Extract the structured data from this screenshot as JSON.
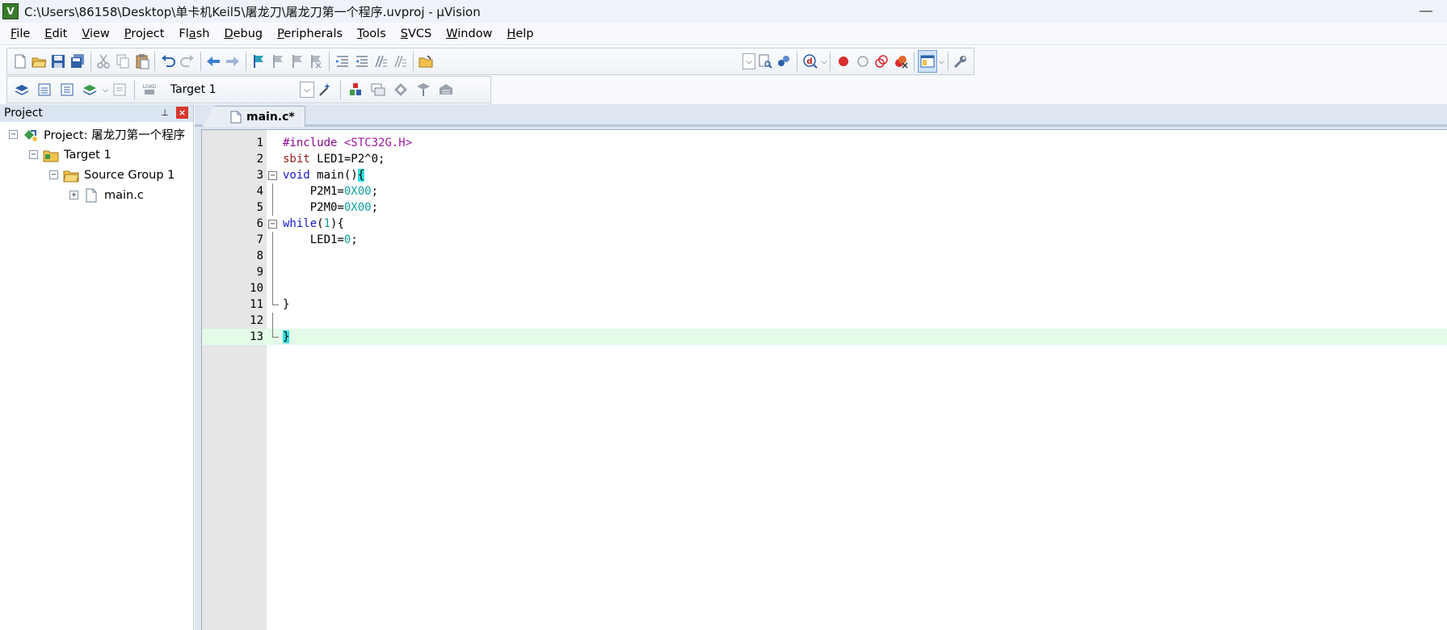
{
  "window": {
    "title": "C:\\Users\\86158\\Desktop\\单卡机Keil5\\屠龙刀\\屠龙刀第一个程序.uvproj - µVision",
    "minimize": "—"
  },
  "menu": [
    {
      "label": "File",
      "u": "F",
      "rest": "ile"
    },
    {
      "label": "Edit",
      "u": "E",
      "rest": "dit"
    },
    {
      "label": "View",
      "u": "V",
      "rest": "iew"
    },
    {
      "label": "Project",
      "u": "P",
      "rest": "roject"
    },
    {
      "label": "Flash",
      "pre": "Fl",
      "u": "a",
      "rest": "sh"
    },
    {
      "label": "Debug",
      "u": "D",
      "rest": "ebug"
    },
    {
      "label": "Peripherals",
      "u": "P",
      "rest": "eripherals"
    },
    {
      "label": "Tools",
      "u": "T",
      "rest": "ools"
    },
    {
      "label": "SVCS",
      "u": "S",
      "rest": "VCS"
    },
    {
      "label": "Window",
      "u": "W",
      "rest": "indow"
    },
    {
      "label": "Help",
      "u": "H",
      "rest": "elp"
    }
  ],
  "toolbar": {
    "target": "Target 1",
    "dropdown_glyph": "⌵"
  },
  "project_panel": {
    "title": "Project",
    "pin": "⊥",
    "close": "×",
    "tree": {
      "root": "Project: 屠龙刀第一个程序",
      "target": "Target 1",
      "group": "Source Group 1",
      "file": "main.c",
      "collapse": "−",
      "expand": "+"
    }
  },
  "editor": {
    "tab": "main.c*",
    "lines": [
      {
        "n": "1"
      },
      {
        "n": "2"
      },
      {
        "n": "3"
      },
      {
        "n": "4"
      },
      {
        "n": "5"
      },
      {
        "n": "6"
      },
      {
        "n": "7"
      },
      {
        "n": "8"
      },
      {
        "n": "9"
      },
      {
        "n": "10"
      },
      {
        "n": "11"
      },
      {
        "n": "12"
      },
      {
        "n": "13"
      }
    ],
    "tokens": {
      "include": "#include",
      "header": "<STC32G.H>",
      "sbit": "sbit",
      "led_decl": " LED1=P2^0;",
      "void": "void",
      "main_sig": " main()",
      "lbrace": "{",
      "rbrace": "}",
      "p2m1": "    P2M1=",
      "p2m0": "    P2M0=",
      "hex0": "0X00",
      "semi": ";",
      "while": "while",
      "while_open": "(",
      "while_one": "1",
      "while_close": "){",
      "led_assign": "    LED1=",
      "zero": "0"
    },
    "colors": {
      "preprocessor": "#8b0a8b",
      "keyword": "#1818c8",
      "number": "#10a0a0",
      "current_line": "#e3fbe7",
      "brace_highlight": "#33e0e0"
    }
  }
}
